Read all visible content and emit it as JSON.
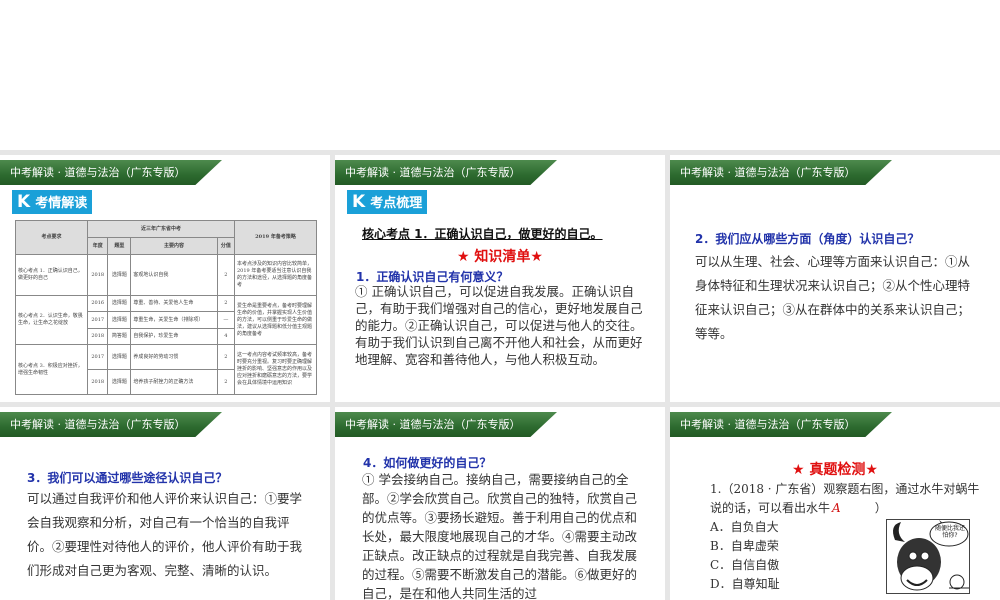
{
  "header": "中考解读 · 道德与法治（广东专版）",
  "slide1": {
    "badge_k": "K",
    "badge": "考情解读",
    "table": {
      "h_req": "考点要求",
      "h_group": "近三年广东省中考",
      "h_strategy": "2019 年备考策略",
      "h_year": "年度",
      "h_type": "题型",
      "h_content": "主要内容",
      "h_score": "分值",
      "groups": [
        {
          "req": "核心考点 1．正确认识自己，做更好的自己",
          "strategy": "本考点涉及的知识内容比较简单，2019 年备考要适当注意认识自我的方法和途径，从选择题的角度备考",
          "rows": [
            [
              "2018",
              "选择题",
              "客观地认识自我",
              "2"
            ]
          ]
        },
        {
          "req": "核心考点 2．认识生命，敬畏生命，让生命之花绽放",
          "strategy": "爱生命是重要考点，备考时要理解生命的价值，并掌握实现人生价值的方法，可以侧重于珍爱生命的做法，建议从选择题和低分值主观题的角度备考",
          "rows": [
            [
              "2016",
              "选择题",
              "尊重、善待、关爱他人生命",
              "2"
            ],
            [
              "2017",
              "选择题",
              "尊重生命，关爱生命（排除项）",
              "—"
            ],
            [
              "2018",
              "简答题",
              "自我保护，珍爱生命",
              "4"
            ]
          ]
        },
        {
          "req": "核心考点 3．积极应对挫折，增强生命韧性",
          "strategy": "这一考点内容考试频率较高，备考时要充分重视。复习时要正确理解挫折的影响、坚强意志的作用以及应对挫折和磨砺意志的方法，要学会在具体情境中运用知识",
          "rows": [
            [
              "2017",
              "选择题",
              "养成良好的劳动习惯",
              "2"
            ],
            [
              "2018",
              "选择题",
              "培养孩子耐挫力的正确方法",
              "2"
            ]
          ]
        }
      ]
    }
  },
  "slide2": {
    "badge_k": "K",
    "badge": "考点梳理",
    "topic": "核心考点 1．正确认识自己，做更好的自己。",
    "star": "★ 知识清单★",
    "q": "1．正确认识自己有何意义？",
    "text": "① 正确认识自己，可以促进自我发展。正确认识自己，有助于我们增强对自己的信心，更好地发展自己的能力。②正确认识自己，可以促进与他人的交往。有助于我们认识到自己离不开他人和社会，从而更好地理解、宽容和善待他人，与他人积极互动。"
  },
  "slide3": {
    "q": "2．我们应从哪些方面（角度）认识自己？",
    "text": "可以从生理、社会、心理等方面来认识自己：①从身体特征和生理状况来认识自己；②从个性心理特征来认识自己；③从在群体中的关系来认识自己；等等。"
  },
  "slide4": {
    "q": "3．我们可以通过哪些途径认识自己？",
    "text": "可以通过自我评价和他人评价来认识自己：①要学会自我观察和分析，对自己有一个恰当的自我评价。②要理性对待他人的评价，他人评价有助于我们形成对自己更为客观、完整、清晰的认识。"
  },
  "slide5": {
    "q": "4．如何做更好的自己？",
    "text": "① 学会接纳自己。接纳自己，需要接纳自己的全部。②学会欣赏自己。欣赏自己的独特，欣赏自己的优点等。③要扬长避短。善于利用自己的优点和长处，最大限度地展现自己的才华。④需要主动改正缺点。改正缺点的过程就是自我完善、自我发展的过程。⑤需要不断激发自己的潜能。⑥做更好的自己，是在和他人共同生活的过"
  },
  "slide6": {
    "star": "★ 真题检测★",
    "q": "1.（2018 · 广东省）观察题右图，通过水牛对蜗牛说的话，可以看出水牛",
    "answer": "A",
    "paren_close": "）",
    "options": [
      "A．自负自大",
      "B．自卑虚荣",
      "C．自信自傲",
      "D．自尊知耻"
    ],
    "bubble": "随便比我还怕你?"
  }
}
